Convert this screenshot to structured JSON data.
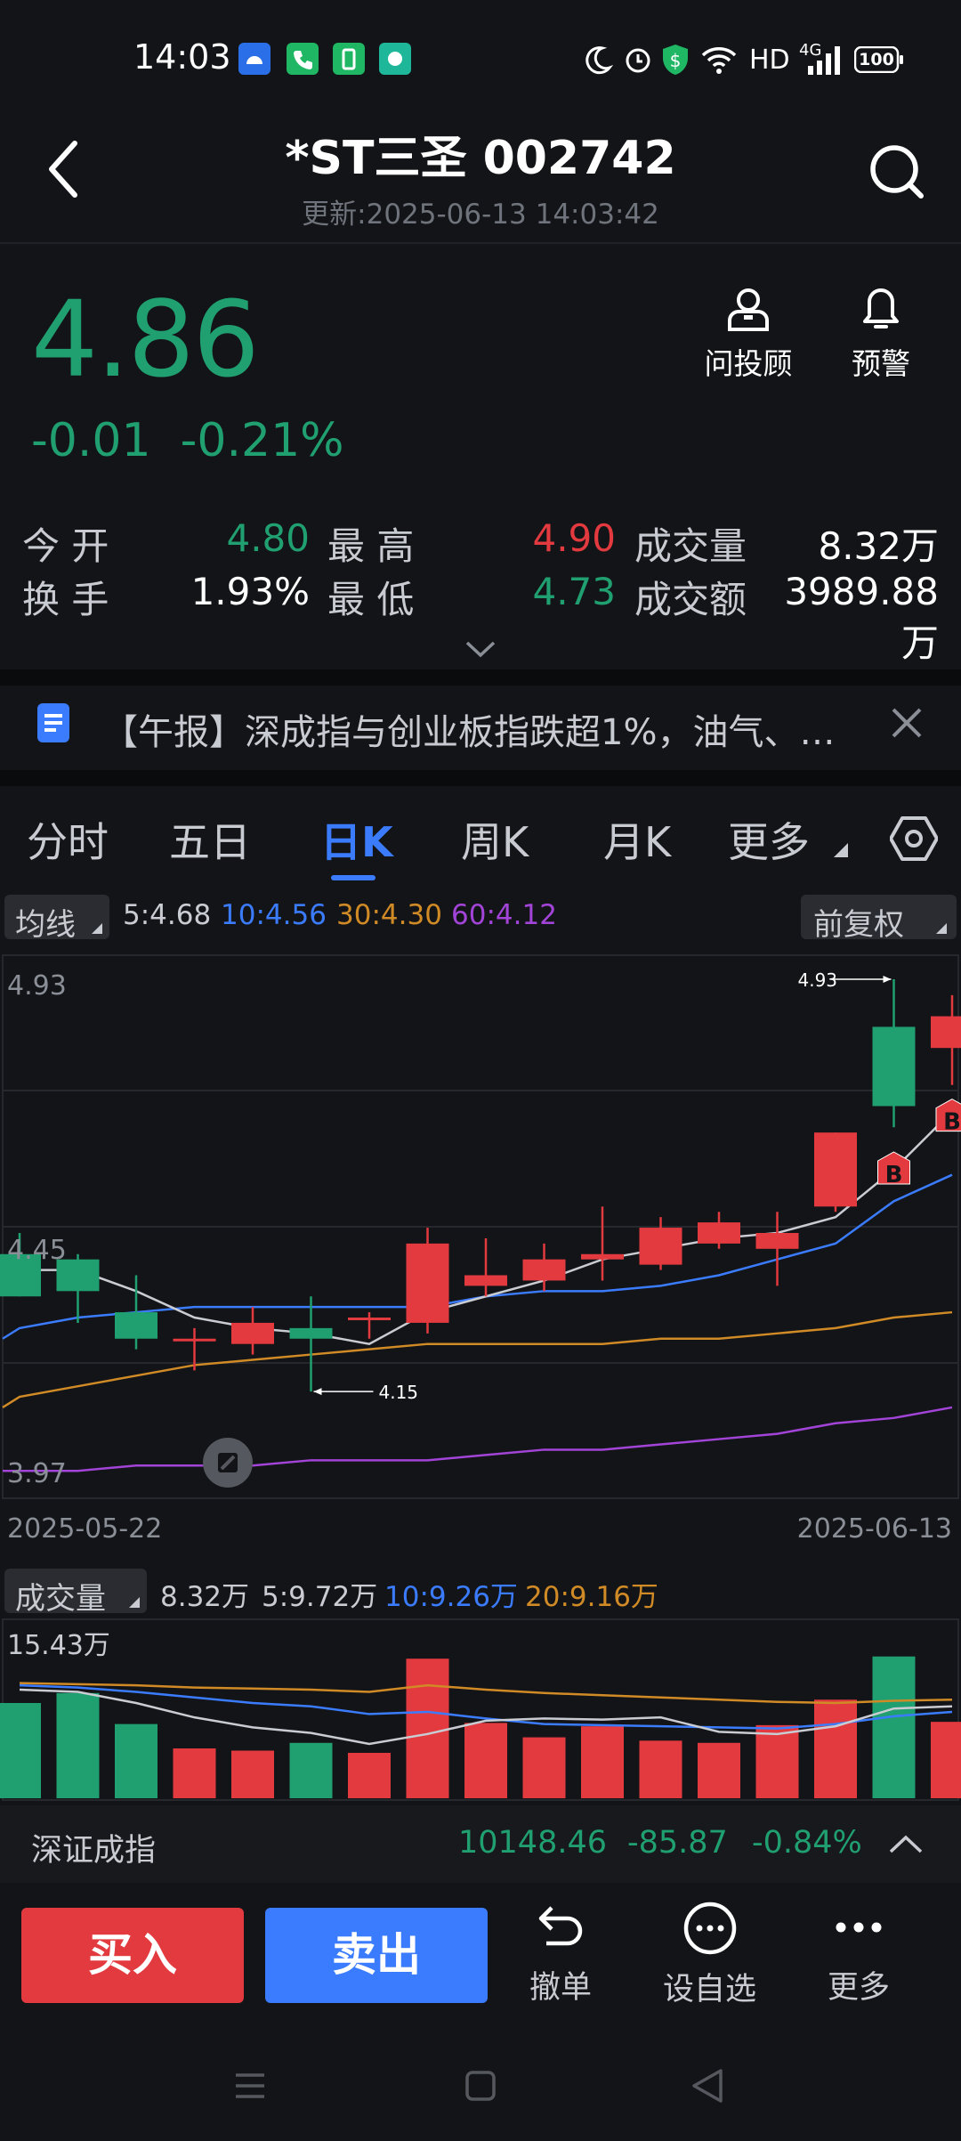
{
  "status_bar": {
    "time": "14:03",
    "network": "HD",
    "signal": "4G",
    "battery": "100",
    "icons": [
      "android-icon",
      "phone-icon",
      "battery-saver-icon",
      "app-icon",
      "moon-icon",
      "alarm-icon",
      "shield-icon",
      "wifi-icon",
      "signal-icon",
      "battery-icon"
    ]
  },
  "header": {
    "title": "*ST三圣 002742",
    "updated": "更新:2025-06-13 14:03:42"
  },
  "quote": {
    "price": "4.86",
    "change": "-0.01",
    "change_pct": "-0.21%",
    "actions": [
      {
        "label": "问投顾",
        "icon": "advisor-icon"
      },
      {
        "label": "预警",
        "icon": "bell-icon"
      }
    ]
  },
  "stats": {
    "open_label": "今 开",
    "open": "4.80",
    "high_label": "最 高",
    "high": "4.90",
    "volume_label": "成交量",
    "volume": "8.32万",
    "turnover_label": "换 手",
    "turnover": "1.93%",
    "low_label": "最 低",
    "low": "4.73",
    "amount_label": "成交额",
    "amount": "3989.88万"
  },
  "news": {
    "text": "【午报】深成指与创业板指跌超1%，油气、…"
  },
  "tabs": [
    {
      "label": "分时"
    },
    {
      "label": "五日"
    },
    {
      "label": "日K"
    },
    {
      "label": "周K"
    },
    {
      "label": "月K"
    },
    {
      "label": "更多"
    }
  ],
  "ma_bar": {
    "selector": "均线",
    "ma5": "5:4.68",
    "ma10": "10:4.56",
    "ma30": "30:4.30",
    "ma60": "60:4.12",
    "adjust": "前复权"
  },
  "kline": {
    "y_top": "4.93",
    "y_mid": "4.45",
    "y_bottom": "3.97",
    "x_start": "2025-05-22",
    "x_end": "2025-06-13",
    "high_marker": "4.93",
    "low_marker": "4.15",
    "buy_marker": "B"
  },
  "volume_bar": {
    "selector": "成交量",
    "current": "8.32万",
    "ma5": "5:9.72万",
    "ma10": "10:9.26万",
    "ma20": "20:9.16万",
    "y_top": "15.43万"
  },
  "index": {
    "name": "深证成指",
    "value": "10148.46",
    "change": "-85.87",
    "change_pct": "-0.84%"
  },
  "bottom": {
    "buy": "买入",
    "sell": "卖出",
    "tools": [
      {
        "label": "撤单",
        "icon": "undo-icon"
      },
      {
        "label": "设自选",
        "icon": "more-circle-icon"
      },
      {
        "label": "更多",
        "icon": "more-dots-icon"
      }
    ]
  },
  "colors": {
    "up": "#e33a3f",
    "down": "#20a071",
    "accent": "#3b7cff",
    "ma5": "#c9ccd3",
    "ma10": "#3b7cff",
    "ma30": "#d08a26",
    "ma60": "#a244d8"
  },
  "chart_data": {
    "type": "candlestick",
    "dates_range": [
      "2025-05-22",
      "2025-06-13"
    ],
    "ylim": [
      3.97,
      4.93
    ],
    "candles": [
      {
        "open": 4.41,
        "close": 4.33,
        "high": 4.45,
        "low": 4.33
      },
      {
        "open": 4.4,
        "close": 4.34,
        "high": 4.41,
        "low": 4.28
      },
      {
        "open": 4.3,
        "close": 4.25,
        "high": 4.37,
        "low": 4.23
      },
      {
        "open": 4.25,
        "close": 4.25,
        "high": 4.27,
        "low": 4.19
      },
      {
        "open": 4.24,
        "close": 4.28,
        "high": 4.31,
        "low": 4.22
      },
      {
        "open": 4.27,
        "close": 4.25,
        "high": 4.33,
        "low": 4.15
      },
      {
        "open": 4.29,
        "close": 4.29,
        "high": 4.3,
        "low": 4.25
      },
      {
        "open": 4.28,
        "close": 4.43,
        "high": 4.46,
        "low": 4.26
      },
      {
        "open": 4.35,
        "close": 4.37,
        "high": 4.44,
        "low": 4.33
      },
      {
        "open": 4.36,
        "close": 4.4,
        "high": 4.43,
        "low": 4.34
      },
      {
        "open": 4.4,
        "close": 4.41,
        "high": 4.5,
        "low": 4.36
      },
      {
        "open": 4.39,
        "close": 4.46,
        "high": 4.48,
        "low": 4.38
      },
      {
        "open": 4.43,
        "close": 4.47,
        "high": 4.49,
        "low": 4.42
      },
      {
        "open": 4.42,
        "close": 4.45,
        "high": 4.49,
        "low": 4.35
      },
      {
        "open": 4.5,
        "close": 4.64,
        "high": 4.64,
        "low": 4.49
      },
      {
        "open": 4.84,
        "close": 4.69,
        "high": 4.93,
        "low": 4.65
      },
      {
        "open": 4.8,
        "close": 4.86,
        "high": 4.9,
        "low": 4.73
      }
    ],
    "ma5": [
      4.38,
      4.38,
      4.34,
      4.29,
      4.27,
      4.26,
      4.24,
      4.3,
      4.33,
      4.36,
      4.4,
      4.42,
      4.44,
      4.45,
      4.48,
      4.57,
      4.68
    ],
    "ma10": [
      4.27,
      4.29,
      4.3,
      4.31,
      4.31,
      4.31,
      4.31,
      4.31,
      4.33,
      4.34,
      4.34,
      4.35,
      4.37,
      4.4,
      4.43,
      4.51,
      4.56
    ],
    "ma30": [
      4.14,
      4.16,
      4.18,
      4.2,
      4.21,
      4.22,
      4.23,
      4.24,
      4.24,
      4.24,
      4.24,
      4.25,
      4.25,
      4.26,
      4.27,
      4.29,
      4.3
    ],
    "ma60": [
      4.0,
      4.0,
      4.01,
      4.01,
      4.01,
      4.02,
      4.02,
      4.02,
      4.03,
      4.04,
      4.04,
      4.05,
      4.06,
      4.07,
      4.09,
      4.1,
      4.12
    ],
    "volume": [
      8.6,
      9.5,
      6.7,
      4.5,
      4.3,
      5.0,
      4.1,
      12.6,
      6.8,
      5.5,
      6.5,
      5.2,
      5.0,
      6.6,
      8.9,
      12.8,
      6.9
    ],
    "volume_ylim": [
      0,
      15.43
    ],
    "vol_ma5": [
      9.8,
      9.6,
      8.6,
      7.3,
      6.4,
      5.9,
      4.9,
      5.8,
      7.0,
      7.2,
      7.1,
      7.3,
      6.0,
      5.8,
      6.5,
      8.1,
      8.3
    ],
    "vol_ma10": [
      10.2,
      10.0,
      9.6,
      9.1,
      8.6,
      8.3,
      7.6,
      7.8,
      7.2,
      6.7,
      6.6,
      6.5,
      6.4,
      6.3,
      6.7,
      7.4,
      7.8
    ],
    "vol_ma20": [
      10.4,
      10.3,
      10.2,
      10.0,
      9.9,
      9.8,
      9.6,
      10.2,
      9.8,
      9.5,
      9.3,
      9.1,
      8.9,
      8.7,
      8.6,
      8.8,
      8.9
    ]
  }
}
